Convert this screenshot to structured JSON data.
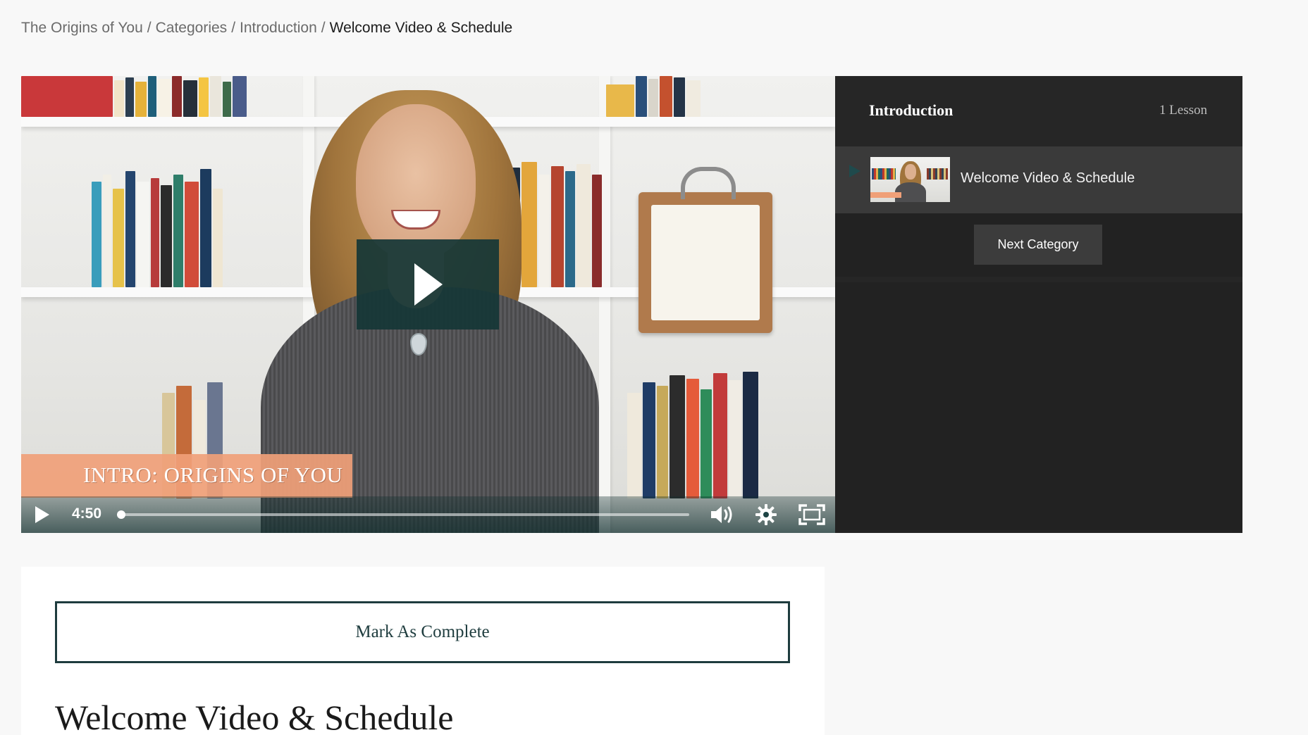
{
  "breadcrumb": {
    "items": [
      "The Origins of You",
      "Categories",
      "Introduction"
    ],
    "separator": "/",
    "current": "Welcome Video & Schedule"
  },
  "video": {
    "caption_overlay": "INTRO: ORIGINS OF YOU",
    "time": "4:50",
    "progress": 0.0,
    "accent_color": "#153636",
    "caption_color": "#f0a078"
  },
  "sidebar": {
    "category_title": "Introduction",
    "lesson_count": "1 Lesson",
    "lessons": [
      {
        "title": "Welcome Video & Schedule",
        "active": true
      }
    ],
    "next_button": "Next Category",
    "background_color": "#222222"
  },
  "content": {
    "mark_complete_label": "Mark As Complete",
    "lesson_heading": "Welcome Video & Schedule",
    "button_border_color": "#1e3c3e"
  },
  "icons": [
    "play-icon",
    "volume-icon",
    "settings-gear-icon",
    "fullscreen-icon",
    "lesson-play-arrow-icon"
  ]
}
